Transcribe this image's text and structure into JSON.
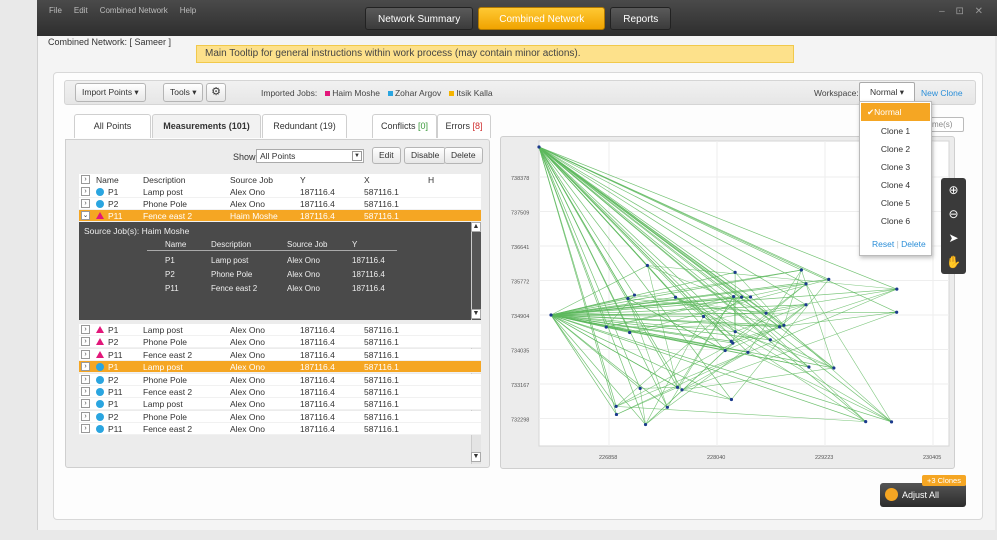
{
  "titlebar": {
    "menu": [
      "File",
      "Edit",
      "Combined Network",
      "Help"
    ],
    "tabs": [
      "Network Summary",
      "Combined Network",
      "Reports"
    ],
    "window_controls": "– ⊡ ✕"
  },
  "context_label": "Combined Network: [ Sameer ]",
  "tooltip": "Main Tooltip for general instructions within work process (may contain minor actions).",
  "toolbar": {
    "import_label": "Import Points ▾",
    "tools_label": "Tools ▾",
    "imported_jobs_label": "Imported Jobs:",
    "jobs": [
      {
        "name": "Haim Moshe",
        "color": "#e2177a"
      },
      {
        "name": "Zohar Argov",
        "color": "#2aa5e0"
      },
      {
        "name": "Itsik Kalla",
        "color": "#f5b400"
      }
    ],
    "workspace_label": "Workspace:",
    "workspace_value": "Normal ▾",
    "new_clone": "New Clone"
  },
  "subtabs": [
    "All Points",
    "Measurements (101)",
    "Redundant (19)",
    "Conflicts [0]",
    "Errors [8]"
  ],
  "table": {
    "show_label": "Show",
    "show_value": "All Points",
    "edit": "Edit",
    "disable": "Disable",
    "delete": "Delete",
    "columns": [
      "Name",
      "Description",
      "Source Job",
      "Y",
      "X",
      "H"
    ],
    "rows_top": [
      {
        "marker": "dot",
        "name": "P1",
        "desc": "Lamp post",
        "job": "Alex Ono",
        "y": "187116.4",
        "x": "587116.1",
        "sel": false
      },
      {
        "marker": "dot",
        "name": "P2",
        "desc": "Phone Pole",
        "job": "Alex Ono",
        "y": "187116.4",
        "x": "587116.1",
        "sel": false
      },
      {
        "marker": "tri",
        "name": "P11",
        "desc": "Fence east 2",
        "job": "Haim Moshe",
        "y": "187116.4",
        "x": "587116.1",
        "sel": true
      }
    ],
    "detail": {
      "title": "Source Job(s): Haim Moshe",
      "columns": [
        "Name",
        "Description",
        "Source Job",
        "Y"
      ],
      "rows": [
        [
          "P1",
          "Lamp post",
          "Alex Ono",
          "187116.4"
        ],
        [
          "P2",
          "Phone Pole",
          "Alex Ono",
          "187116.4"
        ],
        [
          "P11",
          "Fence east 2",
          "Alex Ono",
          "187116.4"
        ]
      ]
    },
    "rows_bottom": [
      {
        "marker": "tri",
        "name": "P1",
        "desc": "Lamp post",
        "job": "Alex Ono",
        "y": "187116.4",
        "x": "587116.1",
        "sel": false
      },
      {
        "marker": "tri",
        "name": "P2",
        "desc": "Phone Pole",
        "job": "Alex Ono",
        "y": "187116.4",
        "x": "587116.1",
        "sel": false
      },
      {
        "marker": "tri",
        "name": "P11",
        "desc": "Fence east 2",
        "job": "Alex Ono",
        "y": "187116.4",
        "x": "587116.1",
        "sel": false
      },
      {
        "marker": "dot",
        "name": "P1",
        "desc": "Lamp post",
        "job": "Alex Ono",
        "y": "187116.4",
        "x": "587116.1",
        "sel": true
      },
      {
        "marker": "dot",
        "name": "P2",
        "desc": "Phone Pole",
        "job": "Alex Ono",
        "y": "187116.4",
        "x": "587116.1",
        "sel": false
      },
      {
        "marker": "dot",
        "name": "P11",
        "desc": "Fence east 2",
        "job": "Alex Ono",
        "y": "187116.4",
        "x": "587116.1",
        "sel": false
      },
      {
        "marker": "dot",
        "name": "P1",
        "desc": "Lamp post",
        "job": "Alex Ono",
        "y": "187116.4",
        "x": "587116.1",
        "sel": false
      },
      {
        "marker": "dot",
        "name": "P2",
        "desc": "Phone Pole",
        "job": "Alex Ono",
        "y": "187116.4",
        "x": "587116.1",
        "sel": false
      },
      {
        "marker": "dot",
        "name": "P11",
        "desc": "Fence east 2",
        "job": "Alex Ono",
        "y": "187116.4",
        "x": "587116.1",
        "sel": false
      }
    ]
  },
  "workspace_menu": {
    "items": [
      "Normal",
      "Clone 1",
      "Clone 2",
      "Clone 3",
      "Clone 4",
      "Clone 5",
      "Clone 6"
    ],
    "selected": "Normal",
    "reset": "Reset",
    "delete": "Delete"
  },
  "search_placeholder": "me(s)",
  "chart": {
    "y_ticks": [
      "738378",
      "737509",
      "736641",
      "735772",
      "734904",
      "734035",
      "733167",
      "732298"
    ],
    "x_ticks": [
      "226858",
      "228040",
      "229223",
      "230405"
    ],
    "line_color": "#5cb85c"
  },
  "adjust": {
    "label": "Adjust All",
    "badge": "+3 Clones"
  }
}
